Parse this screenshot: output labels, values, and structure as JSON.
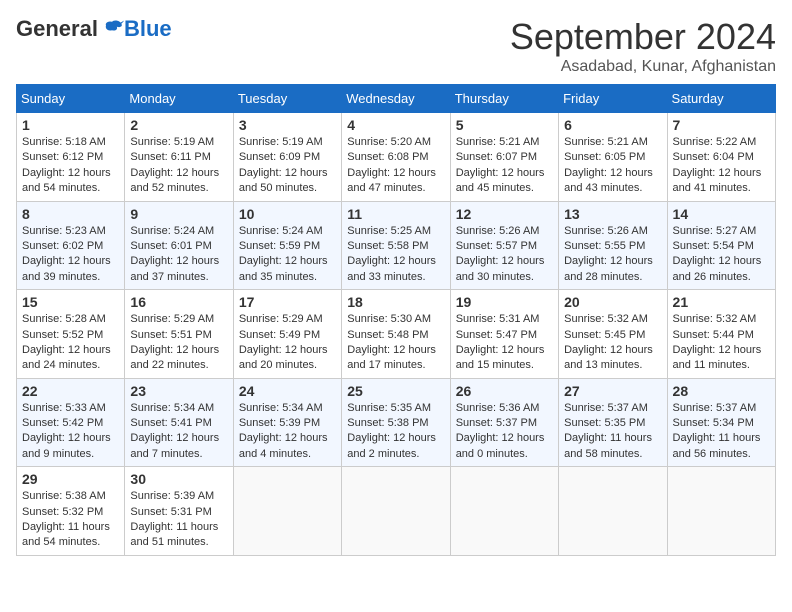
{
  "header": {
    "logo_general": "General",
    "logo_blue": "Blue",
    "month_title": "September 2024",
    "location": "Asadabad, Kunar, Afghanistan"
  },
  "weekdays": [
    "Sunday",
    "Monday",
    "Tuesday",
    "Wednesday",
    "Thursday",
    "Friday",
    "Saturday"
  ],
  "weeks": [
    [
      {
        "day": "1",
        "lines": [
          "Sunrise: 5:18 AM",
          "Sunset: 6:12 PM",
          "Daylight: 12 hours",
          "and 54 minutes."
        ]
      },
      {
        "day": "2",
        "lines": [
          "Sunrise: 5:19 AM",
          "Sunset: 6:11 PM",
          "Daylight: 12 hours",
          "and 52 minutes."
        ]
      },
      {
        "day": "3",
        "lines": [
          "Sunrise: 5:19 AM",
          "Sunset: 6:09 PM",
          "Daylight: 12 hours",
          "and 50 minutes."
        ]
      },
      {
        "day": "4",
        "lines": [
          "Sunrise: 5:20 AM",
          "Sunset: 6:08 PM",
          "Daylight: 12 hours",
          "and 47 minutes."
        ]
      },
      {
        "day": "5",
        "lines": [
          "Sunrise: 5:21 AM",
          "Sunset: 6:07 PM",
          "Daylight: 12 hours",
          "and 45 minutes."
        ]
      },
      {
        "day": "6",
        "lines": [
          "Sunrise: 5:21 AM",
          "Sunset: 6:05 PM",
          "Daylight: 12 hours",
          "and 43 minutes."
        ]
      },
      {
        "day": "7",
        "lines": [
          "Sunrise: 5:22 AM",
          "Sunset: 6:04 PM",
          "Daylight: 12 hours",
          "and 41 minutes."
        ]
      }
    ],
    [
      {
        "day": "8",
        "lines": [
          "Sunrise: 5:23 AM",
          "Sunset: 6:02 PM",
          "Daylight: 12 hours",
          "and 39 minutes."
        ]
      },
      {
        "day": "9",
        "lines": [
          "Sunrise: 5:24 AM",
          "Sunset: 6:01 PM",
          "Daylight: 12 hours",
          "and 37 minutes."
        ]
      },
      {
        "day": "10",
        "lines": [
          "Sunrise: 5:24 AM",
          "Sunset: 5:59 PM",
          "Daylight: 12 hours",
          "and 35 minutes."
        ]
      },
      {
        "day": "11",
        "lines": [
          "Sunrise: 5:25 AM",
          "Sunset: 5:58 PM",
          "Daylight: 12 hours",
          "and 33 minutes."
        ]
      },
      {
        "day": "12",
        "lines": [
          "Sunrise: 5:26 AM",
          "Sunset: 5:57 PM",
          "Daylight: 12 hours",
          "and 30 minutes."
        ]
      },
      {
        "day": "13",
        "lines": [
          "Sunrise: 5:26 AM",
          "Sunset: 5:55 PM",
          "Daylight: 12 hours",
          "and 28 minutes."
        ]
      },
      {
        "day": "14",
        "lines": [
          "Sunrise: 5:27 AM",
          "Sunset: 5:54 PM",
          "Daylight: 12 hours",
          "and 26 minutes."
        ]
      }
    ],
    [
      {
        "day": "15",
        "lines": [
          "Sunrise: 5:28 AM",
          "Sunset: 5:52 PM",
          "Daylight: 12 hours",
          "and 24 minutes."
        ]
      },
      {
        "day": "16",
        "lines": [
          "Sunrise: 5:29 AM",
          "Sunset: 5:51 PM",
          "Daylight: 12 hours",
          "and 22 minutes."
        ]
      },
      {
        "day": "17",
        "lines": [
          "Sunrise: 5:29 AM",
          "Sunset: 5:49 PM",
          "Daylight: 12 hours",
          "and 20 minutes."
        ]
      },
      {
        "day": "18",
        "lines": [
          "Sunrise: 5:30 AM",
          "Sunset: 5:48 PM",
          "Daylight: 12 hours",
          "and 17 minutes."
        ]
      },
      {
        "day": "19",
        "lines": [
          "Sunrise: 5:31 AM",
          "Sunset: 5:47 PM",
          "Daylight: 12 hours",
          "and 15 minutes."
        ]
      },
      {
        "day": "20",
        "lines": [
          "Sunrise: 5:32 AM",
          "Sunset: 5:45 PM",
          "Daylight: 12 hours",
          "and 13 minutes."
        ]
      },
      {
        "day": "21",
        "lines": [
          "Sunrise: 5:32 AM",
          "Sunset: 5:44 PM",
          "Daylight: 12 hours",
          "and 11 minutes."
        ]
      }
    ],
    [
      {
        "day": "22",
        "lines": [
          "Sunrise: 5:33 AM",
          "Sunset: 5:42 PM",
          "Daylight: 12 hours",
          "and 9 minutes."
        ]
      },
      {
        "day": "23",
        "lines": [
          "Sunrise: 5:34 AM",
          "Sunset: 5:41 PM",
          "Daylight: 12 hours",
          "and 7 minutes."
        ]
      },
      {
        "day": "24",
        "lines": [
          "Sunrise: 5:34 AM",
          "Sunset: 5:39 PM",
          "Daylight: 12 hours",
          "and 4 minutes."
        ]
      },
      {
        "day": "25",
        "lines": [
          "Sunrise: 5:35 AM",
          "Sunset: 5:38 PM",
          "Daylight: 12 hours",
          "and 2 minutes."
        ]
      },
      {
        "day": "26",
        "lines": [
          "Sunrise: 5:36 AM",
          "Sunset: 5:37 PM",
          "Daylight: 12 hours",
          "and 0 minutes."
        ]
      },
      {
        "day": "27",
        "lines": [
          "Sunrise: 5:37 AM",
          "Sunset: 5:35 PM",
          "Daylight: 11 hours",
          "and 58 minutes."
        ]
      },
      {
        "day": "28",
        "lines": [
          "Sunrise: 5:37 AM",
          "Sunset: 5:34 PM",
          "Daylight: 11 hours",
          "and 56 minutes."
        ]
      }
    ],
    [
      {
        "day": "29",
        "lines": [
          "Sunrise: 5:38 AM",
          "Sunset: 5:32 PM",
          "Daylight: 11 hours",
          "and 54 minutes."
        ]
      },
      {
        "day": "30",
        "lines": [
          "Sunrise: 5:39 AM",
          "Sunset: 5:31 PM",
          "Daylight: 11 hours",
          "and 51 minutes."
        ]
      },
      {
        "day": "",
        "lines": []
      },
      {
        "day": "",
        "lines": []
      },
      {
        "day": "",
        "lines": []
      },
      {
        "day": "",
        "lines": []
      },
      {
        "day": "",
        "lines": []
      }
    ]
  ]
}
